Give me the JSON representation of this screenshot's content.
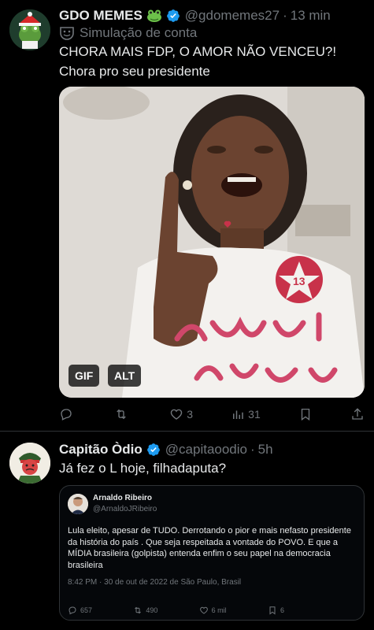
{
  "tweet1": {
    "name": "GDO MEMES",
    "handle": "@gdomemes27",
    "separator": "·",
    "time": "13 min",
    "simulation_label": "Simulação de conta",
    "lines": [
      "CHORA MAIS FDP, O AMOR NÃO VENCEU?!",
      "Chora pro seu presidente"
    ],
    "media": {
      "gif_label": "GIF",
      "alt_label": "ALT"
    },
    "actions": {
      "reply": "",
      "retweet": "",
      "like": "3",
      "views": "31"
    }
  },
  "tweet2": {
    "name": "Capitão Òdio",
    "handle": "@capitaoodio",
    "separator": "·",
    "time": "5h",
    "text": "Já fez o L hoje, filhadaputa?",
    "quote": {
      "name": "Arnaldo Ribeiro",
      "handle": "@ArnaldoJRibeiro",
      "body": "Lula eleito, apesar de TUDO. Derrotando o pior e mais nefasto presidente da história do país . Que seja respeitada a vontade do POVO. E que a MÍDIA brasileira (golpista) entenda enfim o seu papel na democracia brasileira",
      "date": "8:42 PM · 30 de out de 2022 de São Paulo, Brasil",
      "actions": {
        "reply": "657",
        "retweet": "490",
        "like": "6 mil",
        "bookmark": "6"
      }
    }
  },
  "colors": {
    "accent": "#1d9bf0",
    "muted": "#71767b",
    "text": "#e7e9ea",
    "border": "#2f3336"
  }
}
